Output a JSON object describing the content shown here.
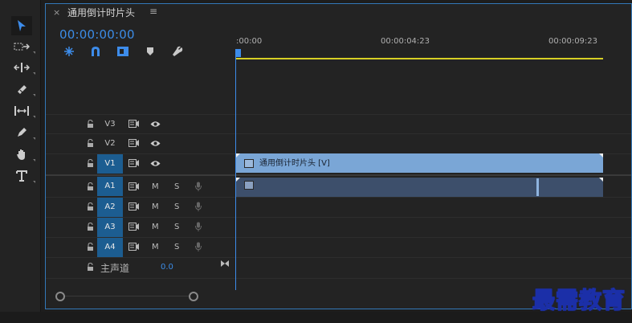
{
  "sequence": {
    "title": "通用倒计时片头",
    "close_label": "×",
    "menu_label": "≡",
    "timecode": "00:00:00:00"
  },
  "toolbar_icons": [
    "snap-icon",
    "linked-selection-icon",
    "add-marker-icon",
    "marker-icon",
    "wrench-icon"
  ],
  "tools": [
    "selection-tool-icon",
    "track-select-tool-icon",
    "ripple-edit-tool-icon",
    "razor-tool-icon",
    "slip-tool-icon",
    "pen-tool-icon",
    "hand-tool-icon",
    "type-tool-icon"
  ],
  "ruler": {
    "ticks": [
      ":00:00",
      "00:00:04:23",
      "00:00:09:23"
    ]
  },
  "video_tracks": [
    {
      "name": "V3",
      "targeted": false
    },
    {
      "name": "V2",
      "targeted": false
    },
    {
      "name": "V1",
      "targeted": true
    }
  ],
  "audio_tracks": [
    {
      "name": "A1",
      "m": "M",
      "s": "S"
    },
    {
      "name": "A2",
      "m": "M",
      "s": "S"
    },
    {
      "name": "A3",
      "m": "M",
      "s": "S"
    },
    {
      "name": "A4",
      "m": "M",
      "s": "S"
    }
  ],
  "master": {
    "label": "主声道",
    "value": "0.0"
  },
  "clips": {
    "v1": "通用倒计时片头 [V]"
  },
  "watermark": "最需教育",
  "colors": {
    "accent": "#3c8ce6",
    "video_clip": "#7aa6d6",
    "audio_clip": "#3d4f6b",
    "targeted_track": "#1c5d91",
    "work_area_bar": "#d7cf25"
  }
}
